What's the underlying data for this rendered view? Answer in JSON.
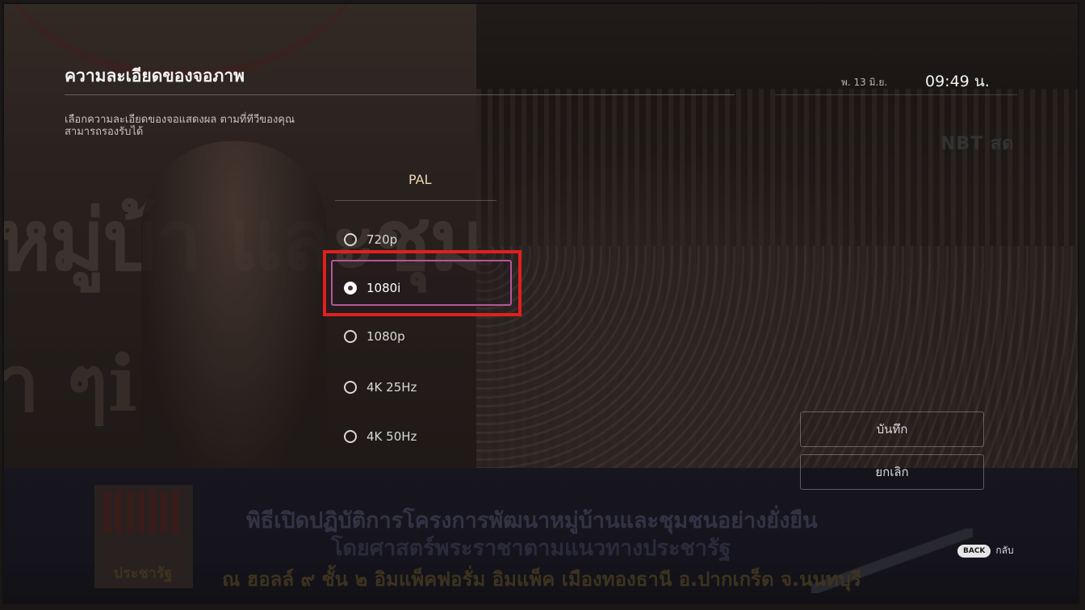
{
  "header": {
    "title": "ความละเอียดของจอภาพ",
    "subtitle": "เลือกความละเอียดของจอแสดงผล ตามที่ทีวีของคุณสามารถรองรับได้",
    "date": "พ. 13 มิ.ย.",
    "time": "09:49 น."
  },
  "background": {
    "channel_logo": "NBT สด",
    "poster_text_1": "หมู่บ้า และชุมชน",
    "poster_text_2": "า            ๆi",
    "banner_logo_text": "ประชารัฐ",
    "banner_line_1": "พิธีเปิดปฏิบัติการโครงการพัฒนาหมู่บ้านและชุมชนอย่างยั่งยืน",
    "banner_line_2": "โดยศาสตร์พระราชาตามแนวทางประชารัฐ",
    "banner_line_3": "ณ ฮอลล์ ๙  ชั้น ๒ อิมแพ็คฟอรั่ม อิมแพ็ค เมืองทองธานี อ.ปากเกร็ด จ.นนทบุรี"
  },
  "resolution": {
    "group_label": "PAL",
    "selected": "1080i",
    "options": [
      {
        "label": "720p",
        "selected": false
      },
      {
        "label": "1080i",
        "selected": true
      },
      {
        "label": "1080p",
        "selected": false
      },
      {
        "label": "4K 25Hz",
        "selected": false
      },
      {
        "label": "4K 50Hz",
        "selected": false
      }
    ]
  },
  "actions": {
    "save_label": "บันทึก",
    "cancel_label": "ยกเลิก"
  },
  "footer": {
    "back_key": "BACK",
    "back_label": "กลับ"
  },
  "colors": {
    "focus_highlight": "#e02020",
    "focus_inner": "#b4569a",
    "group_label": "#e9d9b4"
  }
}
